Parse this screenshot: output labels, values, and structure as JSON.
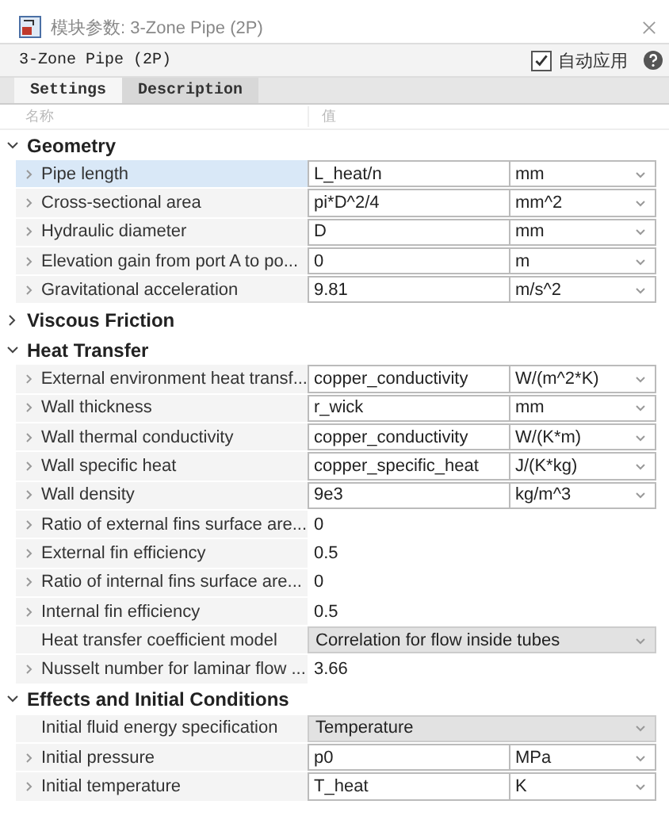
{
  "window": {
    "title": "模块参数: 3-Zone Pipe (2P)"
  },
  "header": {
    "block_name": "3-Zone Pipe (2P)",
    "auto_apply": {
      "label": "自动应用",
      "checked": true
    }
  },
  "tabs": [
    {
      "label": "Settings",
      "selected": true
    },
    {
      "label": "Description",
      "selected": false
    }
  ],
  "table": {
    "columns": [
      "名称",
      "值"
    ],
    "sections": [
      {
        "title": "Geometry",
        "expanded": true,
        "rows": [
          {
            "kind": "unit",
            "label": "Pipe length",
            "value": "L_heat/n",
            "unit": "mm",
            "selected": true
          },
          {
            "kind": "unit",
            "label": "Cross-sectional area",
            "value": "pi*D^2/4",
            "unit": "mm^2",
            "selected": false
          },
          {
            "kind": "unit",
            "label": "Hydraulic diameter",
            "value": "D",
            "unit": "mm",
            "selected": false
          },
          {
            "kind": "unit",
            "label": "Elevation gain from port A to po...",
            "value": "0",
            "unit": "m",
            "selected": false
          },
          {
            "kind": "unit",
            "label": "Gravitational acceleration",
            "value": "9.81",
            "unit": "m/s^2",
            "selected": false
          }
        ]
      },
      {
        "title": "Viscous Friction",
        "expanded": false
      },
      {
        "title": "Heat Transfer",
        "expanded": true,
        "rows": [
          {
            "kind": "unit",
            "label": "External environment heat transf...",
            "value": "copper_conductivity",
            "unit": "W/(m^2*K)",
            "selected": false
          },
          {
            "kind": "unit",
            "label": "Wall thickness",
            "value": "r_wick",
            "unit": "mm",
            "selected": false
          },
          {
            "kind": "unit",
            "label": "Wall thermal conductivity",
            "value": "copper_conductivity",
            "unit": "W/(K*m)",
            "selected": false
          },
          {
            "kind": "unit",
            "label": "Wall specific heat",
            "value": "copper_specific_heat",
            "unit": "J/(K*kg)",
            "selected": false
          },
          {
            "kind": "unit",
            "label": "Wall density",
            "value": "9e3",
            "unit": "kg/m^3",
            "selected": false
          },
          {
            "kind": "plain",
            "label": "Ratio of external fins surface are...",
            "value": "0",
            "selected": false
          },
          {
            "kind": "plain",
            "label": "External fin efficiency",
            "value": "0.5",
            "selected": false
          },
          {
            "kind": "plain",
            "label": "Ratio of internal fins surface are...",
            "value": "0",
            "selected": false
          },
          {
            "kind": "plain",
            "label": "Internal fin efficiency",
            "value": "0.5",
            "selected": false
          },
          {
            "kind": "choice",
            "label": "Heat transfer coefficient model",
            "value": "Correlation for flow inside tubes",
            "selected": false
          },
          {
            "kind": "plain",
            "label": "Nusselt number for laminar flow ...",
            "value": "3.66",
            "selected": false
          }
        ]
      },
      {
        "title": "Effects and Initial Conditions",
        "expanded": true,
        "rows": [
          {
            "kind": "choice",
            "label": "Initial fluid energy specification",
            "value": "Temperature",
            "selected": false
          },
          {
            "kind": "unit",
            "label": "Initial pressure",
            "value": "p0",
            "unit": "MPa",
            "selected": false
          },
          {
            "kind": "unit",
            "label": "Initial temperature",
            "value": "T_heat",
            "unit": "K",
            "selected": false
          }
        ]
      }
    ]
  }
}
